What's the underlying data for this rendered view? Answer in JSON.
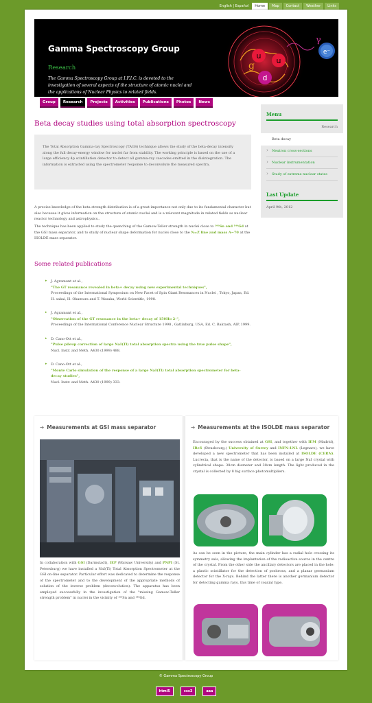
{
  "topnav": {
    "lang_en": "English",
    "lang_es": "Español",
    "tabs": [
      "Home",
      "Map",
      "Contact",
      "Weather",
      "Links"
    ]
  },
  "header": {
    "title": "Gamma Spectroscopy Group",
    "section": "Research",
    "description": "The Gamma Spectroscopy Group at I.F.I.C. is devoted to the investigation of several aspects of the structure of atomic nuclei and the applications of Nuclear Physics to related fields.",
    "logo_letters": {
      "u1": "u",
      "u2": "u",
      "d": "d",
      "g": "g",
      "gamma": "γ",
      "e": "e⁻"
    }
  },
  "mainnav": [
    "Group",
    "Research",
    "Projects",
    "Activities",
    "Publications",
    "Photos",
    "News"
  ],
  "page": {
    "title": "Beta decay studies using total absorption spectroscopy",
    "abstract": "The Total Absorption Gamma-ray Spectroscopy (TAGS) technique allows the study of the beta-decay intensity along the full decay-energy window for nuclei far from stability. The working principle is based on the use of a large efficiency 4p scintillation detector to detect all gamma-ray cascades emitted in the disintegration. The information is extracted using the spectrometer response to deconvolute the measured spectra.",
    "para1": "A precise knowledge of the beta strength distribution is of a great importance not only due to its fundamental character but also because it gives information on the structure of atomic nuclei and is a relevant magnitude in related fields as nuclear reactor technology and astrophysics..",
    "para2": {
      "t1": "The technique has been applied to study the quenching of the Gamow-Teller strength in nuclei close to ",
      "h1": "¹⁰⁰Sn and ¹⁴⁶Gd",
      "t2": " at the GSI mass separator, and to study of nuclear shape deformation for nuclei close to the ",
      "h2": "N=Z line and mass A~70",
      "t3": " at the ISOLDE mass separator."
    },
    "related_heading": "Some related publications"
  },
  "publications": [
    {
      "authors": "J. Agramunt et al.,",
      "title": "\"The GT resonance revealed in beta+ decay using new experimental techniques\",",
      "ref": "Proceedings of the International Symposium on New Facet of Spin Giant Resonances in Nuclei , Tokyo, Japan, Ed. H. sakai, H. Okamura and T. Wasaka, World Scientific, 1998."
    },
    {
      "authors": "J. Agramunt et al.,",
      "title": "\"Observation of the GT resonance in the beta+ decay of 150Ho 2-\",",
      "ref": "Proceedings of the International Conference Nuclear Structure 1998 , Gatlinburg, USA, Ed. C. Baktash, AIP, 1999."
    },
    {
      "authors": "D. Cano-Ott et al.,",
      "title": "\"Pulse pileup correction of large NaI(Tl) total absorption spectra using the true pulse shape\",",
      "ref": "Nucl. Instr. and Meth. A430 (1999) 488."
    },
    {
      "authors": "D. Cano-Ott et al.,",
      "title": "\"Monte Carlo simulation of the response of a large NaI(Tl) total absorption spectrometer for beta-decay studies\",",
      "ref": "Nucl. Instr. and Meth. A430 (1999) 333."
    }
  ],
  "sidebar": {
    "menu_heading": "Menu",
    "section": "Research",
    "current": "Beta decay",
    "items": [
      "Neutron cross-sections",
      "Nuclear instrumentation",
      "Study of extreme nuclear states"
    ],
    "last_update_heading": "Last Update",
    "last_update_date": "April 9th, 2012"
  },
  "gsi": {
    "heading": "Measurements at GSI mass separator",
    "t1": "In collaboration with ",
    "h1": "GSI",
    "t2": " (Darmstadt), ",
    "h2": "IEP",
    "t3": " (Warsaw University) and ",
    "h3": "PNPI",
    "t4": " (St. Petersburg) we have installed a NaI(Tl) Total Absorption Spectrometer at the GSI on-line separator. Particular effort was dedicated to determine the response of the spectrometer and to the development of the appropriate methods of solution of the inverse problem (deconvolution). The apparatus has been employed successfully in the investigation of the \"missing Gamow-Teller strength problem\" in nuclei in the vicinity of ¹⁰⁰Sn and ¹⁴⁶Gd."
  },
  "isolde": {
    "heading": "Measurements at the ISOLDE mass separator",
    "t1": "Encouraged by the success obtained at ",
    "h1": "GSI",
    "t2": ", and together with ",
    "h2": "IEM",
    "t3": " (Madrid), ",
    "h3": "IReS",
    "t4": " (Strasbourg,) ",
    "h4": "University of Surrey",
    "t5": " and ",
    "h5": "INFN-LNL",
    "t6": " (Legnaro), we have developed a new spectrometer that has been installed at ",
    "h6": "ISOLDE (CERN)",
    "t7": ". Lucrecia, that is the name of the detector, is based on a large NaI crystal with cylindrical shape: 38cm diameter and 38cm length. The light produced in the crystal is collected by 8 big surface photomultipliers.",
    "p2": "As can be seen in the picture, the main cylinder has a radial hole crossing its symmetry axis, allowing the implantation of the radioactive source in the centre of the crystal. From the other side the ancillary detectors are placed in the hole: a plastic scintillator for the detection of positrons, and a planar germanium detector for the X-rays. Behind the latter there is another germanium detector for detecting gamma rays, this time of coaxial type."
  },
  "footer": {
    "copyright": "© Gamma Spectroscopy Group",
    "badges": [
      "html5",
      "css3",
      "aaa"
    ]
  },
  "colors": {
    "magenta": "#b0067f",
    "green": "#78b02c",
    "background": "#6c9a2a"
  }
}
